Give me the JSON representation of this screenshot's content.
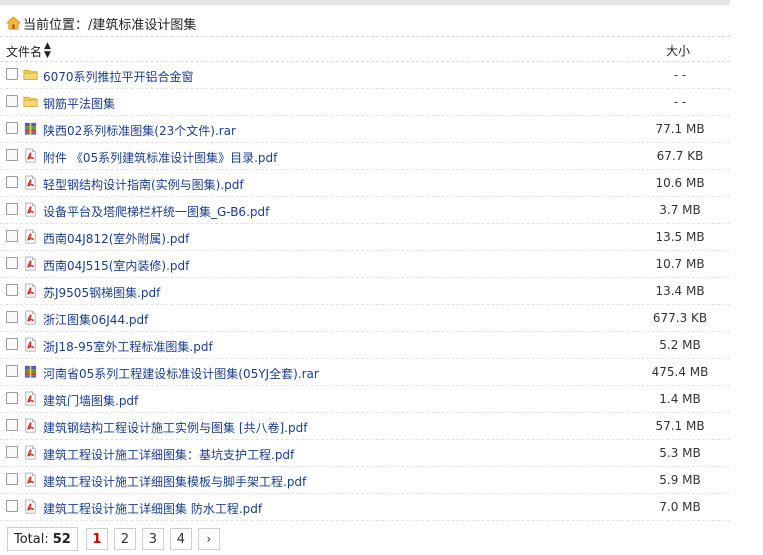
{
  "breadcrumb": {
    "label": "当前位置：",
    "path": "/建筑标准设计图集"
  },
  "table": {
    "header_name": "文件名",
    "header_size": "大小",
    "rows": [
      {
        "type": "folder",
        "name": "6070系列推拉平开铝合金窗",
        "size": "- -"
      },
      {
        "type": "folder",
        "name": "钢筋平法图集",
        "size": "- -"
      },
      {
        "type": "rar",
        "name": "陕西02系列标准图集(23个文件).rar",
        "size": "77.1 MB"
      },
      {
        "type": "pdf",
        "name": "附件 《05系列建筑标准设计图集》目录.pdf",
        "size": "67.7 KB"
      },
      {
        "type": "pdf",
        "name": "轻型钢结构设计指南(实例与图集).pdf",
        "size": "10.6 MB"
      },
      {
        "type": "pdf",
        "name": "设备平台及塔爬梯栏杆统一图集_G-B6.pdf",
        "size": "3.7 MB"
      },
      {
        "type": "pdf",
        "name": "西南04J812(室外附属).pdf",
        "size": "13.5 MB"
      },
      {
        "type": "pdf",
        "name": "西南04J515(室内装修).pdf",
        "size": "10.7 MB"
      },
      {
        "type": "pdf",
        "name": "苏J9505钢梯图集.pdf",
        "size": "13.4 MB"
      },
      {
        "type": "pdf",
        "name": "浙江图集06J44.pdf",
        "size": "677.3 KB"
      },
      {
        "type": "pdf",
        "name": "浙J18-95室外工程标准图集.pdf",
        "size": "5.2 MB"
      },
      {
        "type": "rar",
        "name": "河南省05系列工程建设标准设计图集(05YJ全套).rar",
        "size": "475.4 MB"
      },
      {
        "type": "pdf",
        "name": "建筑门墙图集.pdf",
        "size": "1.4 MB"
      },
      {
        "type": "pdf",
        "name": "建筑钢结构工程设计施工实例与图集 [共八卷].pdf",
        "size": "57.1 MB"
      },
      {
        "type": "pdf",
        "name": "建筑工程设计施工详细图集：基坑支护工程.pdf",
        "size": "5.3 MB"
      },
      {
        "type": "pdf",
        "name": "建筑工程设计施工详细图集模板与脚手架工程.pdf",
        "size": "5.9 MB"
      },
      {
        "type": "pdf",
        "name": "建筑工程设计施工详细图集 防水工程.pdf",
        "size": "7.0 MB"
      }
    ]
  },
  "pagination": {
    "total_label": "Total:",
    "total_count": "52",
    "pages": [
      "1",
      "2",
      "3",
      "4"
    ],
    "current": "1",
    "next_label": "›"
  },
  "colors": {
    "link": "#1a3d8f",
    "current_page": "#cc0000",
    "pdf": "#d62b2b",
    "folder": "#f2c14e"
  }
}
